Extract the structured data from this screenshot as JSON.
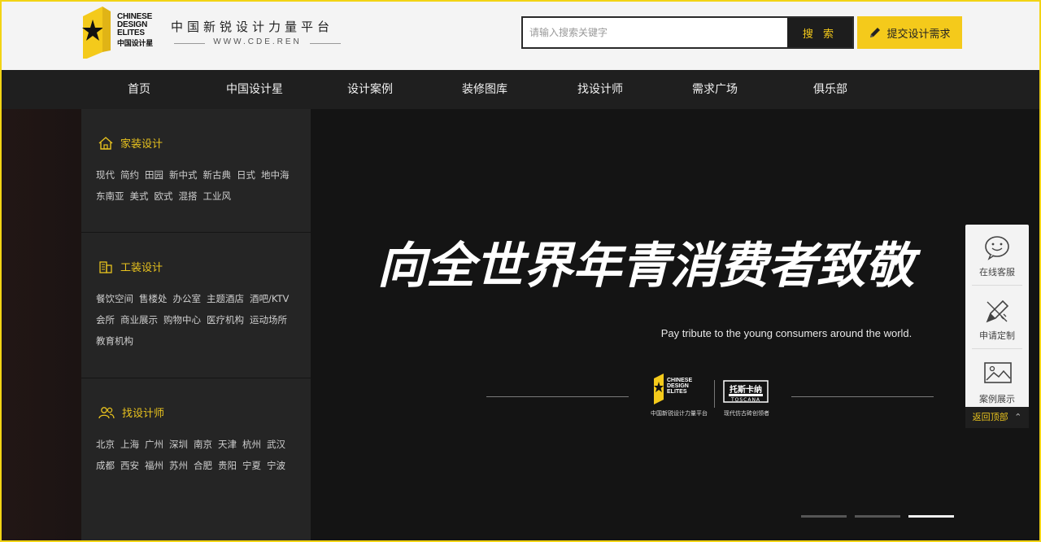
{
  "brand": {
    "logo_lines": [
      "CHINESE",
      "DESIGN",
      "ELITES"
    ],
    "logo_cn": "中国设计星",
    "slogan": "中国新锐设计力量平台",
    "url": "WWW.CDE.REN"
  },
  "search": {
    "placeholder": "请输入搜索关键字",
    "button": "搜 索"
  },
  "submit_button": "提交设计需求",
  "nav": [
    "首页",
    "中国设计星",
    "设计案例",
    "装修图库",
    "找设计师",
    "需求广场",
    "俱乐部"
  ],
  "categories": [
    {
      "title": "家装设计",
      "icon": "home-icon",
      "links": [
        "现代",
        "简约",
        "田园",
        "新中式",
        "新古典",
        "日式",
        "地中海",
        "东南亚",
        "美式",
        "欧式",
        "混搭",
        "工业风"
      ]
    },
    {
      "title": "工装设计",
      "icon": "building-icon",
      "links": [
        "餐饮空间",
        "售楼处",
        "办公室",
        "主题酒店",
        "酒吧/KTV",
        "会所",
        "商业展示",
        "购物中心",
        "医疗机构",
        "运动场所",
        "教育机构"
      ]
    },
    {
      "title": "找设计师",
      "icon": "users-icon",
      "links": [
        "北京",
        "上海",
        "广州",
        "深圳",
        "南京",
        "天津",
        "杭州",
        "武汉",
        "成都",
        "西安",
        "福州",
        "苏州",
        "合肥",
        "贵阳",
        "宁夏",
        "宁波"
      ]
    }
  ],
  "banner": {
    "title": "向全世界年青消费者致敬",
    "subtitle": "Pay tribute to the young consumers around the world.",
    "partner1_caption": "中国新锐设计力量平台",
    "partner2_name": "托斯卡纳",
    "partner2_en": "TOSCANA",
    "partner2_caption": "现代仿古砖创领者",
    "slides": 3,
    "active_slide": 3
  },
  "side_panel": {
    "items": [
      {
        "label": "在线客服",
        "icon": "chat-icon"
      },
      {
        "label": "申请定制",
        "icon": "design-tools-icon"
      },
      {
        "label": "案例展示",
        "icon": "image-icon"
      }
    ],
    "back_top": "返回顶部"
  },
  "colors": {
    "accent": "#f4ca1b",
    "header_bg": "#f4f4f4",
    "nav_bg": "#1f1f1f",
    "panel_bg": "#252525"
  }
}
